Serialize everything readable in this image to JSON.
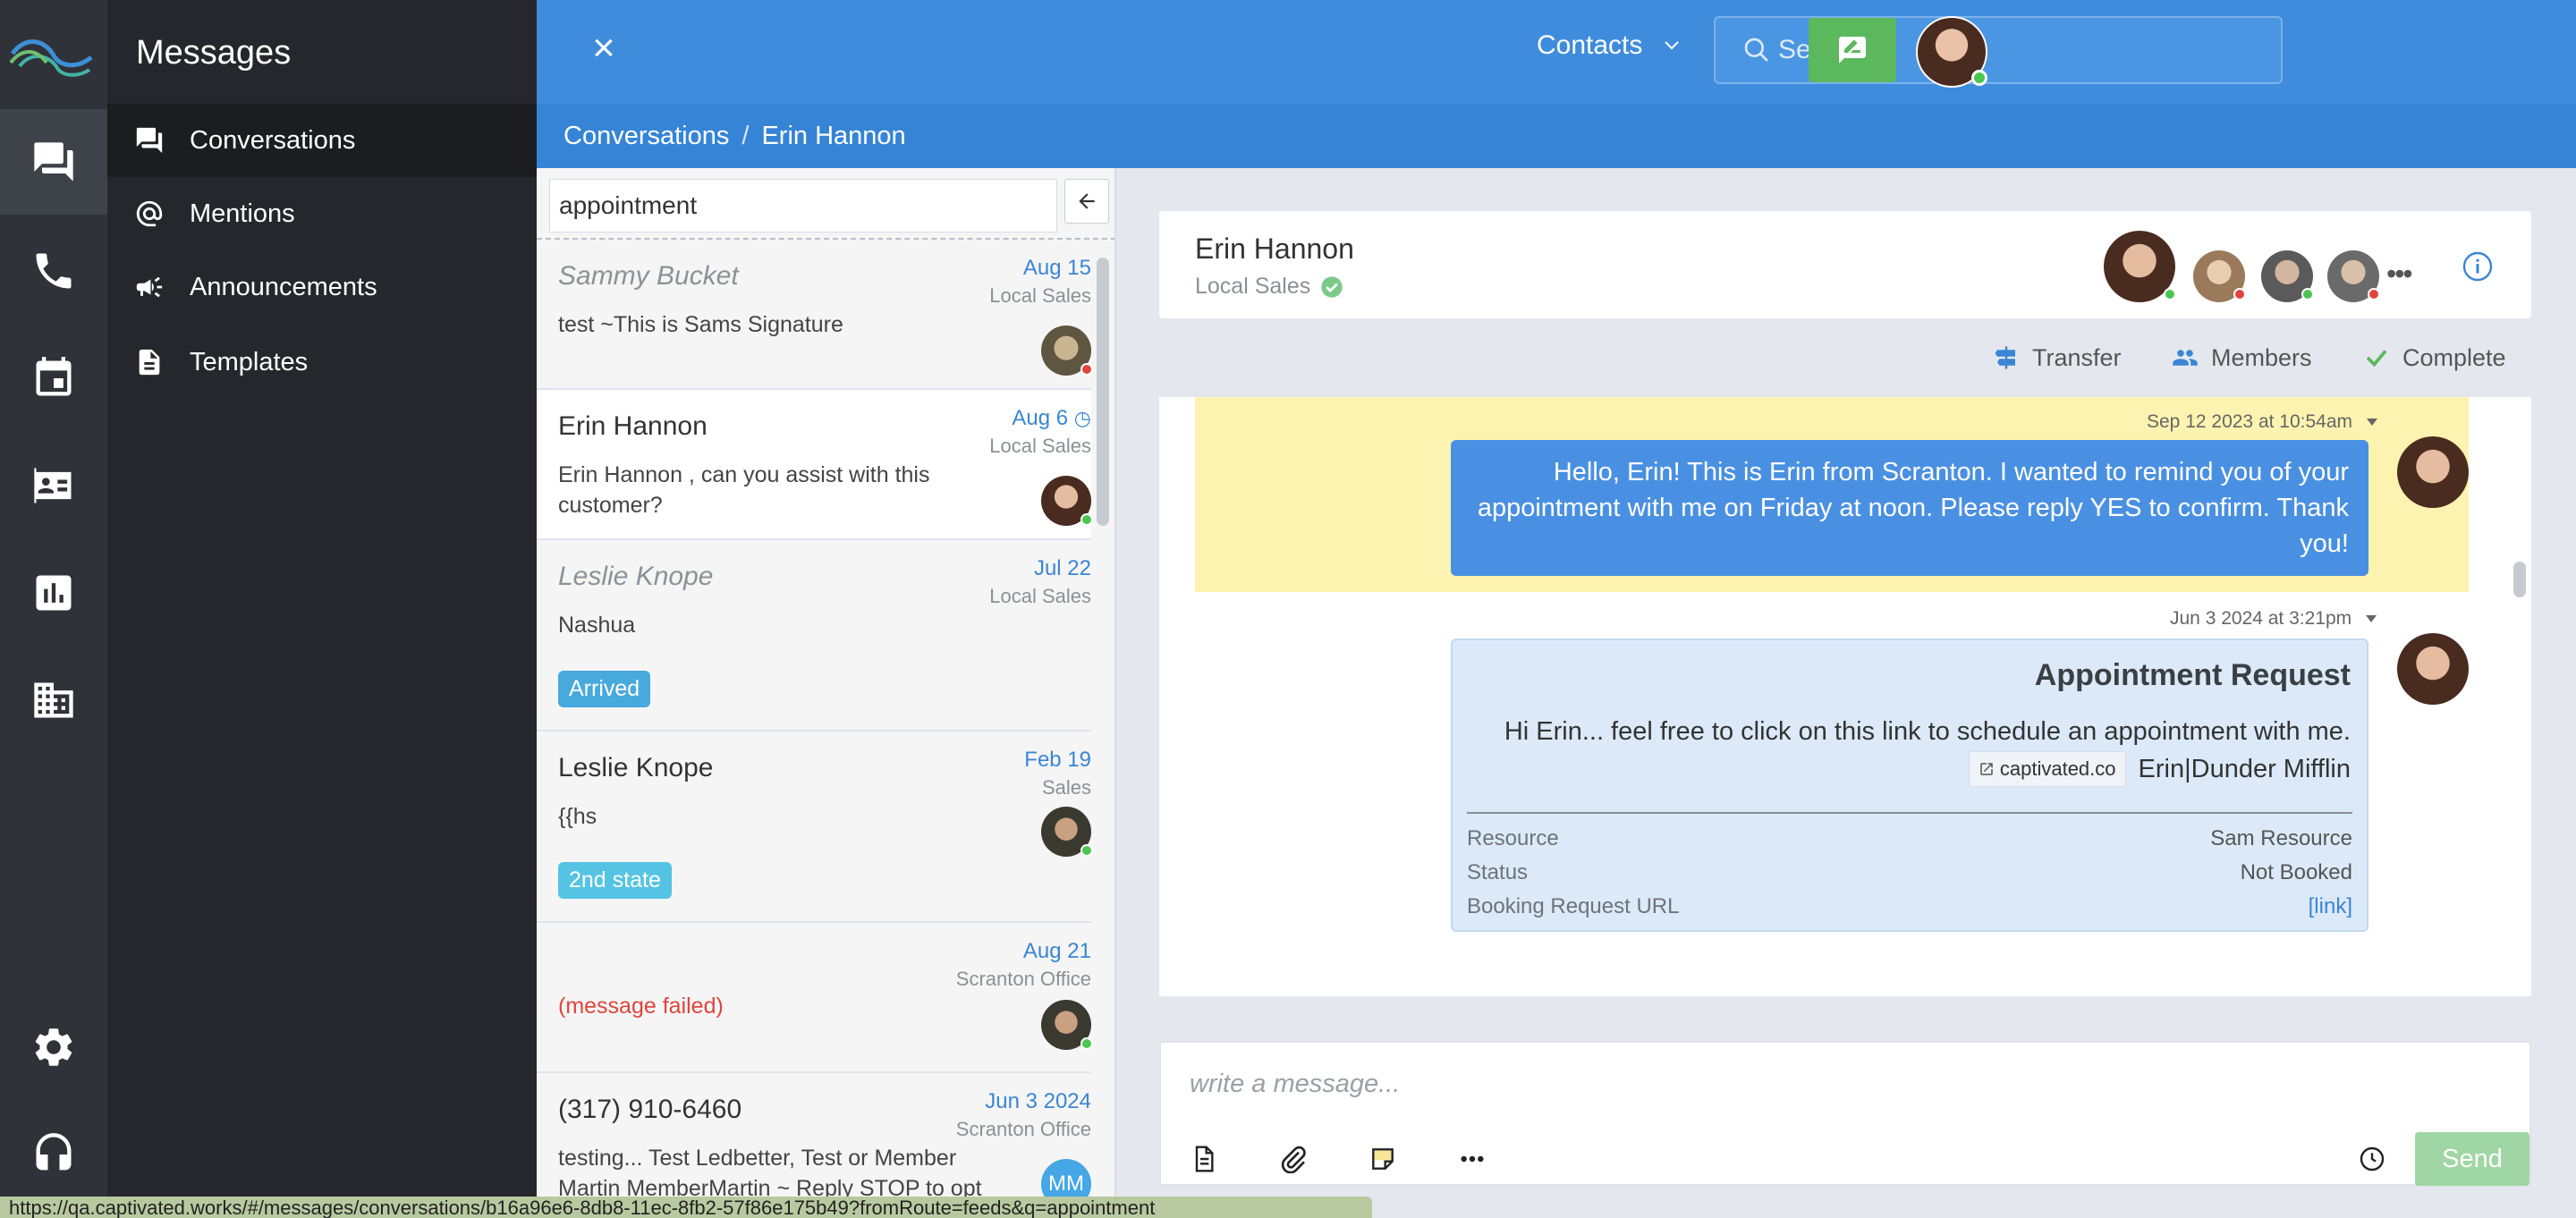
{
  "colors": {
    "accent": "#3f8cdd",
    "rail": "#2f3238",
    "subnav": "#25272c",
    "online": "#4cc552",
    "offline": "#e0453c",
    "highlight": "#fdf3b0",
    "bubble": "#4a90e2",
    "send": "#9fd6a3"
  },
  "rail": {
    "items": [
      {
        "icon": "chat-icon",
        "active": true
      },
      {
        "icon": "phone-icon"
      },
      {
        "icon": "calendar-icon"
      },
      {
        "icon": "contact-card-icon"
      },
      {
        "icon": "chart-icon"
      },
      {
        "icon": "building-icon"
      }
    ],
    "bottom": [
      {
        "icon": "gear-icon"
      },
      {
        "icon": "headset-icon"
      }
    ]
  },
  "subnav": {
    "title": "Messages",
    "items": [
      {
        "label": "Conversations",
        "icon": "conversations-icon",
        "active": true
      },
      {
        "label": "Mentions",
        "icon": "at-icon"
      },
      {
        "label": "Announcements",
        "icon": "megaphone-icon"
      },
      {
        "label": "Templates",
        "icon": "document-icon"
      }
    ]
  },
  "header": {
    "close": "×",
    "contacts_label": "Contacts",
    "search_placeholder": "Search"
  },
  "breadcrumb": {
    "root": "Conversations",
    "separator": "/",
    "current": "Erin Hannon"
  },
  "convlist": {
    "filter_value": "appointment",
    "items": [
      {
        "name": "Sammy Bucket",
        "muted": true,
        "date": "Aug 15",
        "team": "Local Sales",
        "preview": "test ~This is Sams Signature",
        "status": "offline"
      },
      {
        "name": "Erin Hannon",
        "muted": false,
        "selected": true,
        "date": "Aug 6",
        "team": "Local Sales",
        "preview": "Erin Hannon , can you assist with this customer?",
        "status": "online"
      },
      {
        "name": "Leslie Knope",
        "muted": true,
        "date": "Jul 22",
        "team": "Local Sales",
        "preview": "Nashua",
        "tag": "Arrived",
        "tag_color": "#47a9dc"
      },
      {
        "name": "Leslie Knope",
        "muted": false,
        "date": "Feb 19",
        "team": "Sales",
        "preview": "{{hs",
        "tag": "2nd state",
        "tag_color": "#55c3e3",
        "status": "online"
      },
      {
        "name": "",
        "date": "Aug 21",
        "team": "Scranton Office",
        "preview": "(message failed)",
        "failed": true,
        "status": "online"
      },
      {
        "name": "(317) 910-6460",
        "muted": false,
        "date": "Jun 3 2024",
        "team": "Scranton Office",
        "preview": "testing... Test Ledbetter, Test or Member Martin MemberMartin ~ Reply STOP to opt",
        "avatar_initials": "MM",
        "status": "offline"
      }
    ]
  },
  "conversation": {
    "name": "Erin Hannon",
    "team": "Local Sales",
    "more": "•••",
    "actions": {
      "transfer": "Transfer",
      "members": "Members",
      "complete": "Complete"
    },
    "messages": [
      {
        "timestamp": "Sep 12 2023 at 10:54am",
        "text": "Hello, Erin! This is Erin from Scranton. I wanted to remind you of your appointment with me on Friday at noon. Please reply YES to confirm. Thank you!"
      },
      {
        "timestamp": "Jun 3 2024 at 3:21pm",
        "card": {
          "title": "Appointment Request",
          "body": "Hi Erin... feel free to click on this link to schedule an appointment with me.",
          "link_label": "captivated.co",
          "signature": "Erin|Dunder Mifflin",
          "rows": [
            {
              "label": "Resource",
              "value": "Sam Resource"
            },
            {
              "label": "Status",
              "value": "Not Booked"
            },
            {
              "label": "Booking Request URL",
              "value": "[link]"
            }
          ]
        }
      }
    ]
  },
  "composer": {
    "placeholder": "write a message...",
    "send": "Send"
  },
  "statusbar": {
    "url": "https://qa.captivated.works/#/messages/conversations/b16a96e6-8db8-11ec-8fb2-57f86e175b49?fromRoute=feeds&q=appointment"
  }
}
